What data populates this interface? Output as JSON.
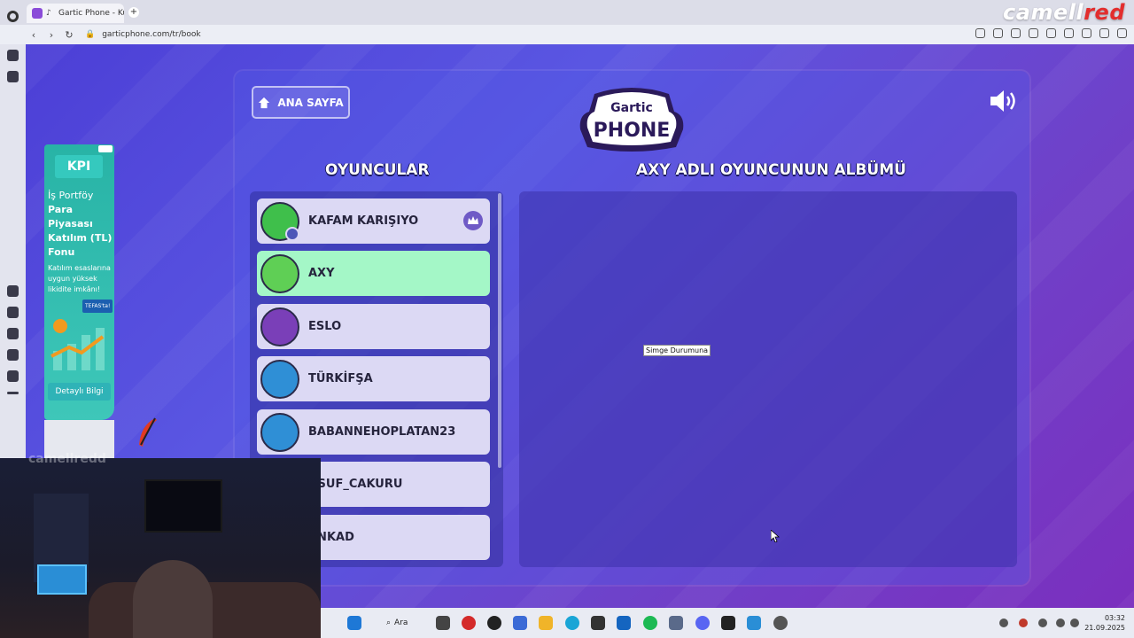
{
  "browser": {
    "tab_title": "Gartic Phone - Kul",
    "url": "garticphone.com/tr/book",
    "new_tab_glyph": "+"
  },
  "brand": {
    "part1": "camell",
    "part2": "red"
  },
  "game": {
    "home_button": "ANA SAYFA",
    "logo_top": "Gartic",
    "logo_bottom": "PHONE",
    "players_title": "OYUNCULAR",
    "album_title": "AXY ADLI OYUNCUNUN ALBÜMÜ",
    "players": [
      {
        "name": "KAFAM KARIŞIYO",
        "owner": true,
        "active": false,
        "avatar_color": "#3fbf4b"
      },
      {
        "name": "AXY",
        "owner": false,
        "active": true,
        "avatar_color": "#5fcf55"
      },
      {
        "name": "ESLO",
        "owner": false,
        "active": false,
        "avatar_color": "#7a3fb8"
      },
      {
        "name": "TÜRKİFŞA",
        "owner": false,
        "active": false,
        "avatar_color": "#2f8fd6"
      },
      {
        "name": "BABANNEHOPLATAN23",
        "owner": false,
        "active": false,
        "avatar_color": "#2f8fd6"
      },
      {
        "name": "USUF_CAKURU",
        "owner": false,
        "active": false,
        "avatar_color": "#d4c8f4"
      },
      {
        "name": "ANKAD",
        "owner": false,
        "active": false,
        "avatar_color": "#d4c8f4"
      }
    ]
  },
  "tooltip": "Simge Durumuna",
  "ad": {
    "badge": "KPI",
    "line1": "İş Portföy",
    "line2": "Para Piyasası Katılım (TL) Fonu",
    "line3": "Katılım esaslarına uygun yüksek likidite imkânı!",
    "tefas": "TEFAS'ta!",
    "cta": "Detaylı Bilgi"
  },
  "webcam_label": "camellredd",
  "taskbar": {
    "search_label": "Ara",
    "time": "03:32",
    "date": "21.09.2025"
  },
  "colors": {
    "active_player": "#a4f7c7",
    "player": "#dcd9f4",
    "accent": "#6f5ac6"
  }
}
